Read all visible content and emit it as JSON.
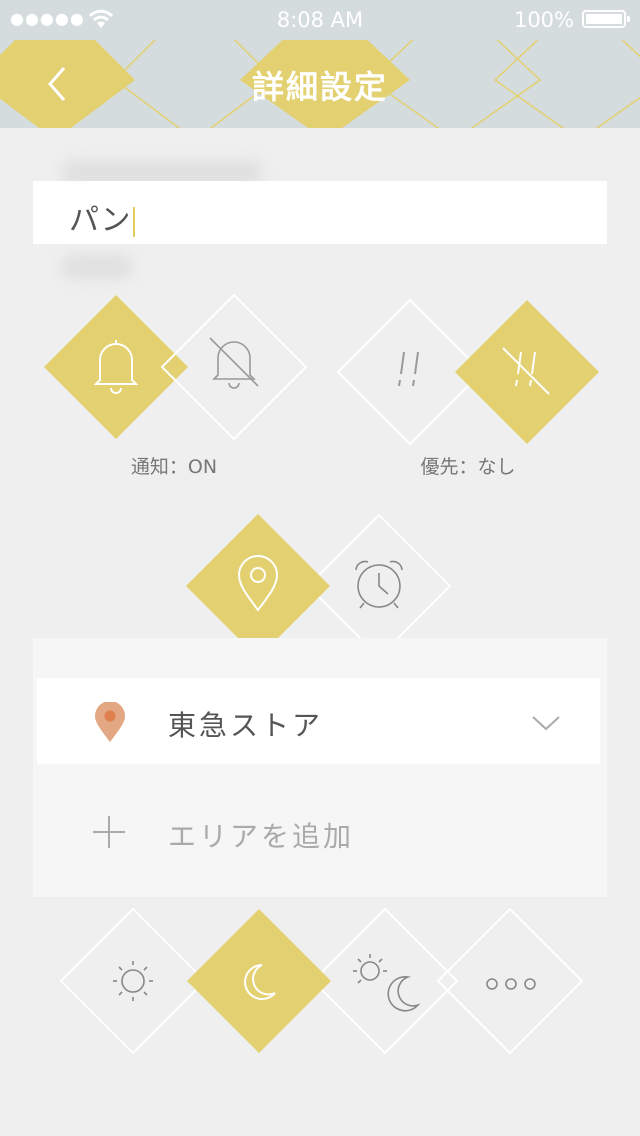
{
  "status_bar": {
    "signal": "●●●●●",
    "time": "8:08 AM",
    "battery": "100%"
  },
  "nav": {
    "title": "詳細設定"
  },
  "title_field": {
    "value": "パン"
  },
  "notification": {
    "caption": "通知：ON",
    "state": "on"
  },
  "priority": {
    "caption": "優先：なし",
    "state": "none"
  },
  "mode": {
    "selected": "location"
  },
  "location": {
    "name": "東急ストア",
    "add_label": "エリアを追加"
  },
  "time_of_day": {
    "selected": "night"
  },
  "colors": {
    "accent": "#e3d070",
    "pin": "#e3a783",
    "nav_bg": "#d5dcdd",
    "bg": "#efefef"
  }
}
